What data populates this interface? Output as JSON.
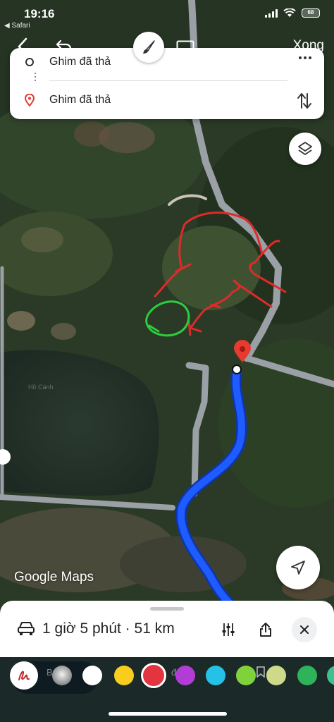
{
  "status_bar": {
    "time": "19:16",
    "back_app": "◀ Safari",
    "battery": "68"
  },
  "markup_toolbar": {
    "done_label": "Xong",
    "tools": [
      "back-icon",
      "undo-icon",
      "pen-icon",
      "rectangle-icon"
    ]
  },
  "route_card": {
    "from": "Ghim đã thả",
    "to": "Ghim đã thả",
    "icons": [
      "circle-origin-icon",
      "pin-icon",
      "more-icon",
      "swap-icon"
    ]
  },
  "map": {
    "logo": "Google Maps",
    "faint_label": "Hồ Cánh",
    "route_color": "#1a4fe0",
    "road_color": "#9aa0a6",
    "destination_pin_color": "#e63b2e",
    "annotation_colors": [
      "#e02a2a",
      "#2ecc40"
    ]
  },
  "bottom_sheet": {
    "trip_summary": "1 giờ 5 phút · 51 km",
    "icons": [
      "car-icon",
      "options-icon",
      "share-icon",
      "close-icon"
    ]
  },
  "palette": {
    "labels": [
      "Bút đ",
      "đ",
      "ư"
    ],
    "swatches": [
      {
        "name": "gray",
        "color": "#b5b5b5"
      },
      {
        "name": "white",
        "color": "#ffffff"
      },
      {
        "name": "yellow",
        "color": "#f8cd1e"
      },
      {
        "name": "red",
        "color": "#e23540",
        "selected": true
      },
      {
        "name": "purple",
        "color": "#b43cd6"
      },
      {
        "name": "cyan",
        "color": "#25c1e6"
      },
      {
        "name": "lime",
        "color": "#7fd23a"
      },
      {
        "name": "khaki",
        "color": "#cfd98a"
      },
      {
        "name": "green",
        "color": "#2db35a"
      },
      {
        "name": "teal",
        "color": "#3cc28e"
      }
    ]
  }
}
